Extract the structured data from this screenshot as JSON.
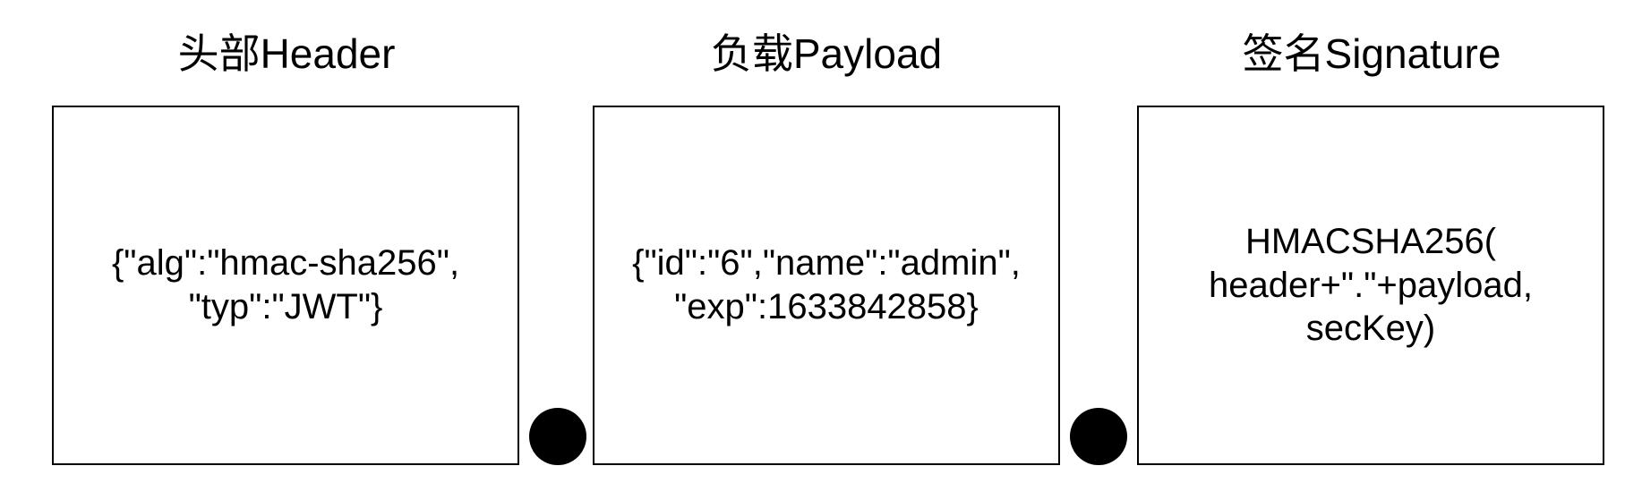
{
  "sections": [
    {
      "title": "头部Header",
      "content": "{\"alg\":\"hmac-sha256\",\n\"typ\":\"JWT\"}"
    },
    {
      "title": "负载Payload",
      "content": "{\"id\":\"6\",\"name\":\"admin\",\n\"exp\":1633842858}"
    },
    {
      "title": "签名Signature",
      "content": "HMACSHA256(\nheader+\".\"+payload,\nsecKey)"
    }
  ],
  "colors": {
    "line": "#000000",
    "background": "#ffffff"
  }
}
